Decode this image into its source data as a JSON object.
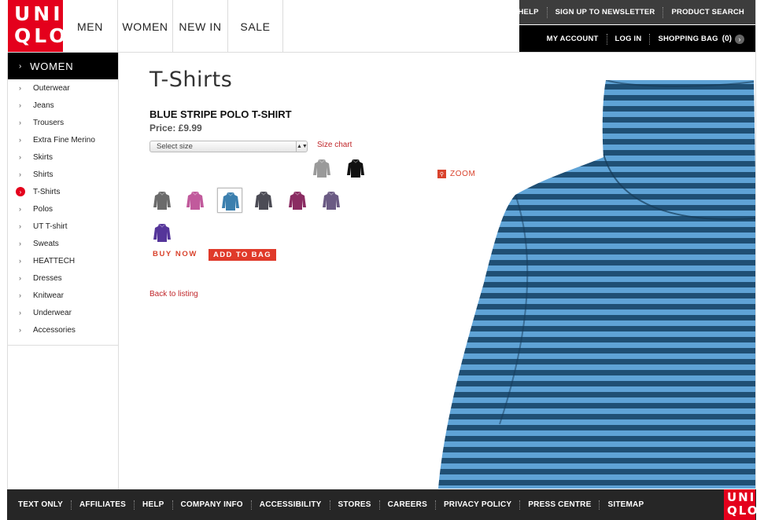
{
  "brand": {
    "logo_line1": "UNI",
    "logo_line2": "QLO"
  },
  "main_nav": [
    {
      "label": "MEN"
    },
    {
      "label": "WOMEN"
    },
    {
      "label": "NEW IN"
    },
    {
      "label": "SALE"
    }
  ],
  "utility_top": [
    {
      "label": "HELP"
    },
    {
      "label": "SIGN UP TO NEWSLETTER"
    },
    {
      "label": "PRODUCT SEARCH"
    }
  ],
  "utility_bottom": {
    "my_account": "MY ACCOUNT",
    "log_in": "LOG IN",
    "shopping_bag": "SHOPPING BAG",
    "bag_count": "(0)"
  },
  "sidebar": {
    "heading": "WOMEN",
    "items": [
      {
        "label": "Outerwear"
      },
      {
        "label": "Jeans"
      },
      {
        "label": "Trousers"
      },
      {
        "label": "Extra Fine Merino"
      },
      {
        "label": "Skirts"
      },
      {
        "label": "Shirts"
      },
      {
        "label": "T-Shirts",
        "active": true
      },
      {
        "label": "Polos"
      },
      {
        "label": "UT T-shirt"
      },
      {
        "label": "Sweats"
      },
      {
        "label": "HEATTECH"
      },
      {
        "label": "Dresses"
      },
      {
        "label": "Knitwear"
      },
      {
        "label": "Underwear"
      },
      {
        "label": "Accessories"
      }
    ]
  },
  "main": {
    "page_title": "T-Shirts",
    "product_name": "BLUE STRIPE POLO T-SHIRT",
    "price": "Price: £9.99",
    "size_select": "Select size",
    "size_chart": "Size chart",
    "zoom": "ZOOM",
    "buy_now": "BUY NOW",
    "add_to_bag": "ADD TO BAG",
    "back_link": "Back to listing"
  },
  "swatches": [
    {
      "color": "#9a9a9a",
      "name": "grey"
    },
    {
      "color": "#111111",
      "name": "black"
    },
    {
      "color": "#6b6b6b",
      "name": "dark-grey"
    },
    {
      "color": "#c15a9c",
      "name": "pink"
    },
    {
      "color": "#3b7fae",
      "name": "blue",
      "selected": true
    },
    {
      "color": "#4c4c55",
      "name": "charcoal"
    },
    {
      "color": "#8a2c62",
      "name": "plum"
    },
    {
      "color": "#6b5b84",
      "name": "mauve"
    },
    {
      "color": "#55359a",
      "name": "purple"
    }
  ],
  "footer": [
    {
      "label": "TEXT ONLY"
    },
    {
      "label": "AFFILIATES"
    },
    {
      "label": "HELP"
    },
    {
      "label": "COMPANY INFO"
    },
    {
      "label": "ACCESSIBILITY"
    },
    {
      "label": "STORES"
    },
    {
      "label": "CAREERS"
    },
    {
      "label": "PRIVACY POLICY"
    },
    {
      "label": "PRESS CENTRE"
    },
    {
      "label": "SITEMAP"
    }
  ],
  "colors": {
    "brand_red": "#e4001c",
    "link_red": "#c0262a",
    "stripe_light": "#5fa3d6",
    "stripe_dark": "#1f4f74"
  }
}
